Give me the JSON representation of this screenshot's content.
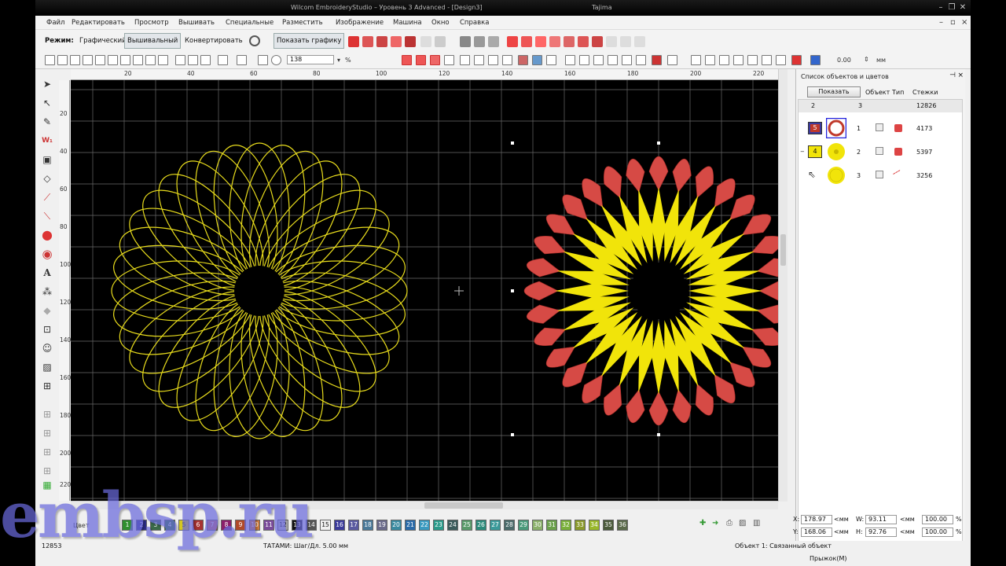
{
  "app": {
    "title": "Wilcom EmbroideryStudio – Уровень 3 Advanced - [Design3]",
    "title_extra": "Tajima"
  },
  "menu": [
    "Файл",
    "Редактировать",
    "Просмотр",
    "Вышивать",
    "Специальные",
    "Разместить",
    "Изображение",
    "Машина",
    "Окно",
    "Справка"
  ],
  "toolbar1": {
    "mode_label": "Режим:",
    "graphic": "Графический",
    "embroidery": "Вышивальный",
    "convert": "Конвертировать",
    "show_graphics": "Показать графику"
  },
  "toolbar2": {
    "zoom": "138",
    "zoom_unit": "%",
    "stitch_value": "0.00",
    "stitch_unit": "мм"
  },
  "rulers": {
    "h": [
      "20",
      "40",
      "60",
      "80",
      "100",
      "120",
      "140",
      "160",
      "180",
      "200",
      "220"
    ],
    "v": [
      "20",
      "40",
      "60",
      "80",
      "100",
      "120",
      "140",
      "160",
      "180",
      "200",
      "220"
    ]
  },
  "panel": {
    "title": "Список объектов и цветов",
    "show_button": "Показать",
    "col_object": "Объект",
    "col_type": "Тип",
    "col_stitches": "Стежки",
    "summary": {
      "a": "2",
      "b": "3",
      "stitches": "12826"
    },
    "rows": [
      {
        "seq": "5",
        "index": "1",
        "stitches": "4173",
        "color": "#c0392b"
      },
      {
        "seq": "4",
        "index": "2",
        "stitches": "5397",
        "color": "#f1e40a"
      },
      {
        "seq": "",
        "index": "3",
        "stitches": "3256",
        "color": "#f1e40a"
      }
    ]
  },
  "palette": {
    "label": "Цвет",
    "numbers": [
      "1",
      "2",
      "3",
      "4",
      "5",
      "6",
      "7",
      "8",
      "9",
      "10",
      "11",
      "12",
      "13",
      "14",
      "15",
      "16",
      "17",
      "18",
      "19",
      "20",
      "21",
      "22",
      "23",
      "24",
      "25",
      "26",
      "27",
      "28",
      "29",
      "30",
      "31",
      "32",
      "33",
      "34",
      "35",
      "36"
    ],
    "colors": [
      "#2f8f2f",
      "#2d2d8a",
      "#3a6a4a",
      "#2c7a2c",
      "#d4c71f",
      "#a83232",
      "#d06a6a",
      "#8a1f6a",
      "#b04a2a",
      "#d07a3a",
      "#7a4a9a",
      "#c8c8c8",
      "#111111",
      "#555555",
      "#f0f0f0",
      "#3a3a9a",
      "#5a5aa0",
      "#4a7a9a",
      "#6a6a8a",
      "#3a8aa0",
      "#2a6aa8",
      "#3a9ac0",
      "#2a9a8a",
      "#3a5a5a",
      "#5a9a6a",
      "#2a8a7a",
      "#3a9a9a",
      "#4a6a6a",
      "#4a9a7a",
      "#8ab06a",
      "#6aa04a",
      "#7ab03a",
      "#8a9a2a",
      "#9ab82a",
      "#4a5a3a",
      "#5a6a4a"
    ]
  },
  "coords": {
    "x_label": "X:",
    "x_value": "178.97",
    "y_label": "Y:",
    "y_value": "168.06",
    "w_label": "W:",
    "w_value": "93.11",
    "h_label": "H:",
    "h_value": "92.76",
    "unit": "<мм",
    "scale_x": "100.00",
    "scale_y": "100.00",
    "pct": "%"
  },
  "status": {
    "left": "12853",
    "mid": "ТАТАМИ: Шаг/Дл. 5.00 мм",
    "object": "Объект 1: Связанный объект",
    "jump": "Прыжок(М)"
  },
  "watermark": "embsp.ru"
}
